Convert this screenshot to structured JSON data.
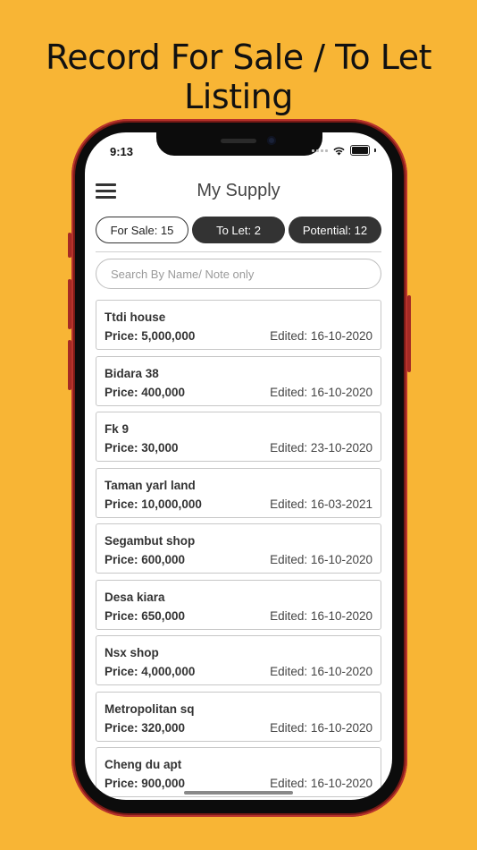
{
  "headline": "Record For Sale / To Let Listing",
  "status_bar": {
    "time": "9:13"
  },
  "header": {
    "title": "My Supply"
  },
  "tabs": [
    {
      "label": "For Sale: 15"
    },
    {
      "label": "To Let: 2"
    },
    {
      "label": "Potential: 12"
    }
  ],
  "search": {
    "placeholder": "Search By Name/ Note only",
    "value": ""
  },
  "listings": [
    {
      "name": "Ttdi house",
      "price": "Price: 5,000,000",
      "edited": "Edited: 16-10-2020"
    },
    {
      "name": "Bidara 38",
      "price": "Price: 400,000",
      "edited": "Edited: 16-10-2020"
    },
    {
      "name": "Fk 9",
      "price": "Price: 30,000",
      "edited": "Edited: 23-10-2020"
    },
    {
      "name": "Taman yarl land",
      "price": "Price: 10,000,000",
      "edited": "Edited: 16-03-2021"
    },
    {
      "name": "Segambut shop",
      "price": "Price: 600,000",
      "edited": "Edited: 16-10-2020"
    },
    {
      "name": "Desa kiara",
      "price": "Price: 650,000",
      "edited": "Edited: 16-10-2020"
    },
    {
      "name": "Nsx shop",
      "price": "Price: 4,000,000",
      "edited": "Edited: 16-10-2020"
    },
    {
      "name": "Metropolitan sq",
      "price": "Price: 320,000",
      "edited": "Edited: 16-10-2020"
    },
    {
      "name": "Cheng du apt",
      "price": "Price: 900,000",
      "edited": "Edited: 16-10-2020"
    }
  ],
  "colors": {
    "background": "#F8B535",
    "tab_dark": "#333333",
    "frame": "#7a1a16"
  }
}
